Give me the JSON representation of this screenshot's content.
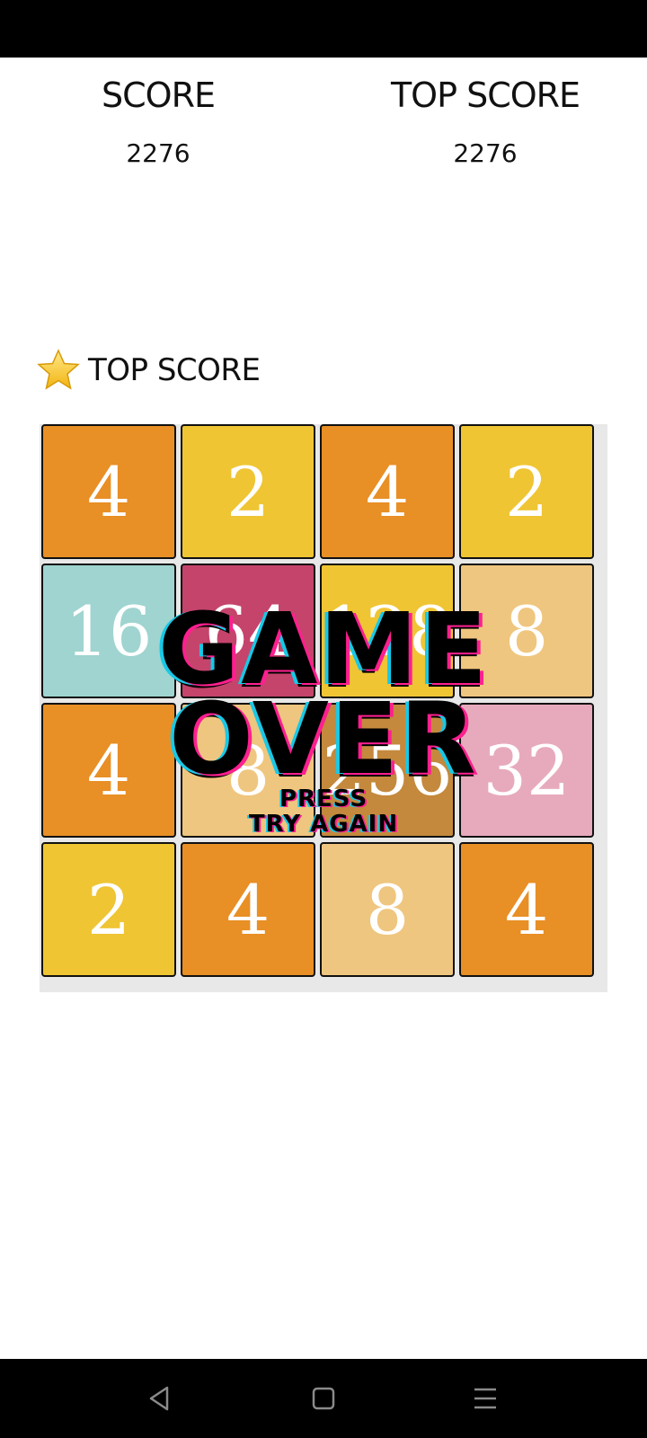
{
  "score": {
    "label": "SCORE",
    "value": "2276"
  },
  "top_score": {
    "label": "TOP SCORE",
    "value": "2276"
  },
  "top_score_link": {
    "label": "TOP SCORE",
    "icon": "star-icon"
  },
  "board": {
    "rows": [
      [
        {
          "v": "4",
          "color": "#e88f25"
        },
        {
          "v": "2",
          "color": "#efc534"
        },
        {
          "v": "4",
          "color": "#e88f25"
        },
        {
          "v": "2",
          "color": "#efc534"
        }
      ],
      [
        {
          "v": "16",
          "color": "#9fd4d0"
        },
        {
          "v": "64",
          "color": "#c5446b"
        },
        {
          "v": "128",
          "color": "#efc534"
        },
        {
          "v": "8",
          "color": "#efc67f"
        }
      ],
      [
        {
          "v": "4",
          "color": "#e88f25"
        },
        {
          "v": "8",
          "color": "#efc67f"
        },
        {
          "v": "256",
          "color": "#c4893d"
        },
        {
          "v": "32",
          "color": "#e7aabc"
        }
      ],
      [
        {
          "v": "2",
          "color": "#efc534"
        },
        {
          "v": "4",
          "color": "#e88f25"
        },
        {
          "v": "8",
          "color": "#efc67f"
        },
        {
          "v": "4",
          "color": "#e88f25"
        }
      ]
    ]
  },
  "game_over": {
    "line1": "GAME",
    "line2": "OVER",
    "sub1": "PRESS",
    "sub2": "TRY AGAIN"
  },
  "nav": {
    "back": "back-icon",
    "home": "home-icon",
    "menu": "menu-icon"
  }
}
